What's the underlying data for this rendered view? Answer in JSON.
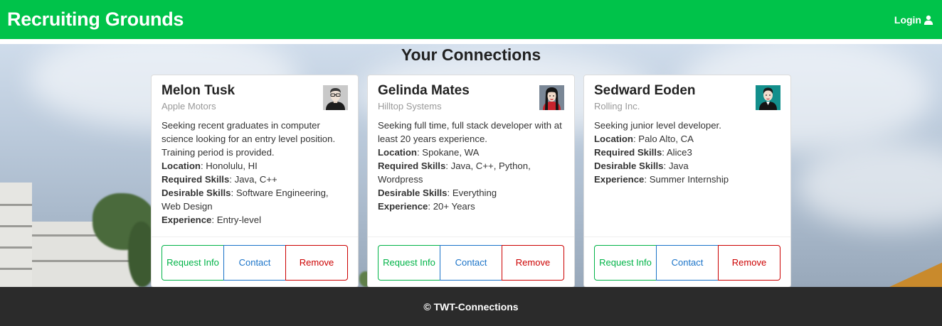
{
  "navbar": {
    "brand": "Recruiting Grounds",
    "login_label": "Login",
    "color": "#00c34a"
  },
  "page_title": "Your Connections",
  "cards": [
    {
      "name": "Melon Tusk",
      "company": "Apple Motors",
      "avatar_icon": "man-glasses-avatar",
      "description": "Seeking recent graduates in computer science looking for an entry level position. Training period is provided.",
      "location_label": "Location",
      "location": "Honolulu, HI",
      "required_label": "Required Skills",
      "required": "Java, C++",
      "desirable_label": "Desirable Skills",
      "desirable": "Software Engineering, Web Design",
      "experience_label": "Experience",
      "experience": "Entry-level",
      "buttons": {
        "request": "Request Info",
        "contact": "Contact",
        "remove": "Remove"
      }
    },
    {
      "name": "Gelinda Mates",
      "company": "Hilltop Systems",
      "avatar_icon": "woman-red-hair-avatar",
      "description": "Seeking full time, full stack developer with at least 20 years experience.",
      "location_label": "Location",
      "location": "Spokane, WA",
      "required_label": "Required Skills",
      "required": "Java, C++, Python, Wordpress",
      "desirable_label": "Desirable Skills",
      "desirable": "Everything",
      "experience_label": "Experience",
      "experience": "20+ Years",
      "buttons": {
        "request": "Request Info",
        "contact": "Contact",
        "remove": "Remove"
      }
    },
    {
      "name": "Sedward Eoden",
      "company": "Rolling Inc.",
      "avatar_icon": "man-teal-background-avatar",
      "description": "Seeking junior level developer.",
      "location_label": "Location",
      "location": "Palo Alto, CA",
      "required_label": "Required Skills",
      "required": "Alice3",
      "desirable_label": "Desirable Skills",
      "desirable": "Java",
      "experience_label": "Experience",
      "experience": "Summer Internship",
      "buttons": {
        "request": "Request Info",
        "contact": "Contact",
        "remove": "Remove"
      }
    }
  ],
  "footer": {
    "text": "© TWT-Connections"
  },
  "colors": {
    "request": "#00b347",
    "contact": "#1a73c8",
    "remove": "#cc0000",
    "footer": "#2b2b2b"
  }
}
